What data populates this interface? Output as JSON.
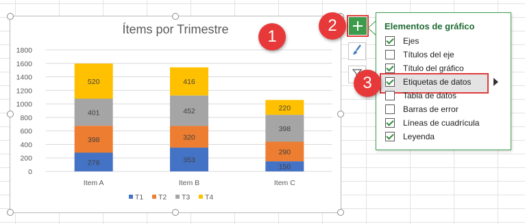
{
  "chart_data": {
    "type": "bar",
    "stacked": true,
    "title": "Ítems por Trimestre",
    "categories": [
      "Item A",
      "Item B",
      "Item C"
    ],
    "series": [
      {
        "name": "T1",
        "values": [
          278,
          353,
          150
        ],
        "color": "#4472c4"
      },
      {
        "name": "T2",
        "values": [
          398,
          320,
          290
        ],
        "color": "#ed7d31"
      },
      {
        "name": "T3",
        "values": [
          401,
          452,
          398
        ],
        "color": "#a5a5a5"
      },
      {
        "name": "T4",
        "values": [
          520,
          416,
          220
        ],
        "color": "#ffc000"
      }
    ],
    "ylim": [
      0,
      1800
    ],
    "yticks": [
      0,
      200,
      400,
      600,
      800,
      1000,
      1200,
      1400,
      1600,
      1800
    ],
    "grid": true,
    "legend_position": "bottom",
    "data_labels": true
  },
  "steps": {
    "one": "1",
    "two": "2",
    "three": "3"
  },
  "side_buttons": {
    "add": "chart-elements-icon",
    "style": "paintbrush-icon",
    "filter": "filter-icon"
  },
  "panel": {
    "title": "Elementos de gráfico",
    "options": [
      {
        "label": "Ejes",
        "checked": true
      },
      {
        "label": "Títulos del eje",
        "checked": false
      },
      {
        "label": "Título del gráfico",
        "checked": true
      },
      {
        "label": "Etiquetas de datos",
        "checked": true
      },
      {
        "label": "Tabla de datos",
        "checked": false
      },
      {
        "label": "Barras de error",
        "checked": false
      },
      {
        "label": "Líneas de cuadrícula",
        "checked": true
      },
      {
        "label": "Leyenda",
        "checked": true
      }
    ]
  },
  "colors": {
    "accent_red": "#e8393a",
    "accent_green": "#3c9c4b"
  }
}
